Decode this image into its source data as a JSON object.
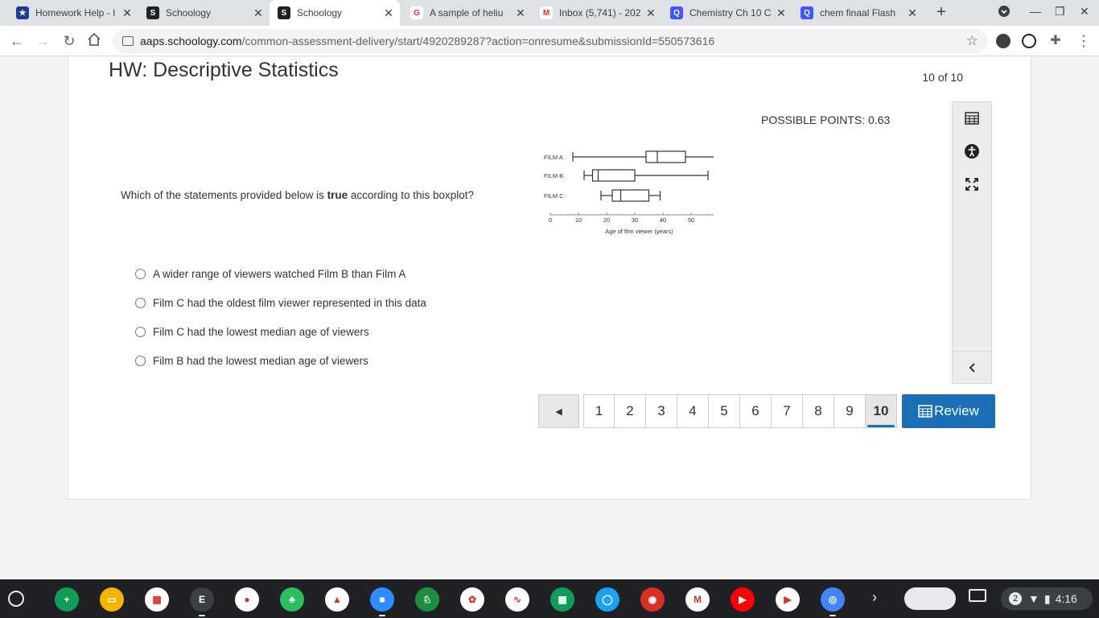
{
  "browser": {
    "tabs": [
      {
        "title": "Homework Help - I",
        "favicon_color": "#1c3f94",
        "favicon_glyph": "★",
        "favicon_name": "homework-help-icon",
        "active": false
      },
      {
        "title": "Schoology",
        "favicon_color": "#202124",
        "favicon_glyph": "S",
        "favicon_name": "schoology-icon",
        "active": false
      },
      {
        "title": "Schoology",
        "favicon_color": "#202124",
        "favicon_glyph": "S",
        "favicon_name": "schoology-icon",
        "active": true
      },
      {
        "title": "A sample of heliu",
        "favicon_color": "#ffffff",
        "favicon_glyph": "G",
        "favicon_name": "google-icon",
        "active": false
      },
      {
        "title": "Inbox (5,741) - 202",
        "favicon_color": "#ffffff",
        "favicon_glyph": "M",
        "favicon_name": "gmail-icon",
        "active": false
      },
      {
        "title": "Chemistry Ch 10 C",
        "favicon_color": "#4255ff",
        "favicon_glyph": "Q",
        "favicon_name": "quizlet-icon",
        "active": false
      },
      {
        "title": "chem finaal Flash",
        "favicon_color": "#4255ff",
        "favicon_glyph": "Q",
        "favicon_name": "quizlet-icon",
        "active": false
      }
    ],
    "url_domain": "aaps.schoology.com",
    "url_path": "/common-assessment-delivery/start/4920289287?action=onresume&submissionId=550573616"
  },
  "assessment": {
    "title": "HW: Descriptive Statistics",
    "counter": "10 of 10",
    "possible_points": "POSSIBLE POINTS: 0.63",
    "question_before": "Which of the statements provided below is ",
    "question_bold": "true",
    "question_after": " according to this boxplot?",
    "choices": [
      "A wider range of viewers watched Film B than Film A",
      "Film C had the oldest film viewer represented in this data",
      "Film C had the lowest median age of viewers",
      "Film B had the lowest median age of viewers"
    ],
    "pages": [
      "1",
      "2",
      "3",
      "4",
      "5",
      "6",
      "7",
      "8",
      "9",
      "10"
    ],
    "current_page": "10",
    "review_label": "Review",
    "prev_label": "◀"
  },
  "chart_data": {
    "type": "boxplot",
    "xlabel": "Age of film viewer (years)",
    "xlim": [
      0,
      70
    ],
    "xticks": [
      0,
      10,
      20,
      30,
      40,
      50,
      60,
      70
    ],
    "series": [
      {
        "name": "FILM A",
        "min": 8,
        "q1": 34,
        "median": 38,
        "q3": 48,
        "max": 64
      },
      {
        "name": "FILM B",
        "min": 12,
        "q1": 15,
        "median": 17,
        "q3": 30,
        "max": 56
      },
      {
        "name": "FILM C",
        "min": 18,
        "q1": 22,
        "median": 25,
        "q3": 35,
        "max": 39
      }
    ]
  },
  "shelf": {
    "apps": [
      {
        "name": "sheets-app-icon",
        "color": "#0f9d58",
        "glyph": "+"
      },
      {
        "name": "slides-app-icon",
        "color": "#f4b400",
        "glyph": "▭"
      },
      {
        "name": "calculator-app-icon",
        "color": "#ffffff",
        "glyph": "▦"
      },
      {
        "name": "epic-app-icon",
        "color": "#3c4043",
        "glyph": "E"
      },
      {
        "name": "screencast-app-icon",
        "color": "#ffffff",
        "glyph": "●"
      },
      {
        "name": "evernote-app-icon",
        "color": "#2dbe60",
        "glyph": "♣"
      },
      {
        "name": "drive-app-icon",
        "color": "#ffffff",
        "glyph": "▲"
      },
      {
        "name": "zoom-app-icon",
        "color": "#2d8cff",
        "glyph": "■"
      },
      {
        "name": "classroom-app-icon",
        "color": "#1e8e3e",
        "glyph": "♘"
      },
      {
        "name": "canvas-app-icon",
        "color": "#ffffff",
        "glyph": "✿"
      },
      {
        "name": "desmos-app-icon",
        "color": "#ffffff",
        "glyph": "∿"
      },
      {
        "name": "google-sheets-app-icon",
        "color": "#0f9d58",
        "glyph": "▦"
      },
      {
        "name": "chat-app-icon",
        "color": "#1ea1f1",
        "glyph": "◯"
      },
      {
        "name": "photobooth-app-icon",
        "color": "#d93025",
        "glyph": "◉"
      },
      {
        "name": "gmail-app-icon",
        "color": "#ffffff",
        "glyph": "M"
      },
      {
        "name": "youtube-app-icon",
        "color": "#ff0000",
        "glyph": "▶"
      },
      {
        "name": "play-store-app-icon",
        "color": "#ffffff",
        "glyph": "▶"
      },
      {
        "name": "chrome-app-icon",
        "color": "#4285f4",
        "glyph": "◎"
      }
    ],
    "notification_count": "2",
    "time": "4:16"
  }
}
